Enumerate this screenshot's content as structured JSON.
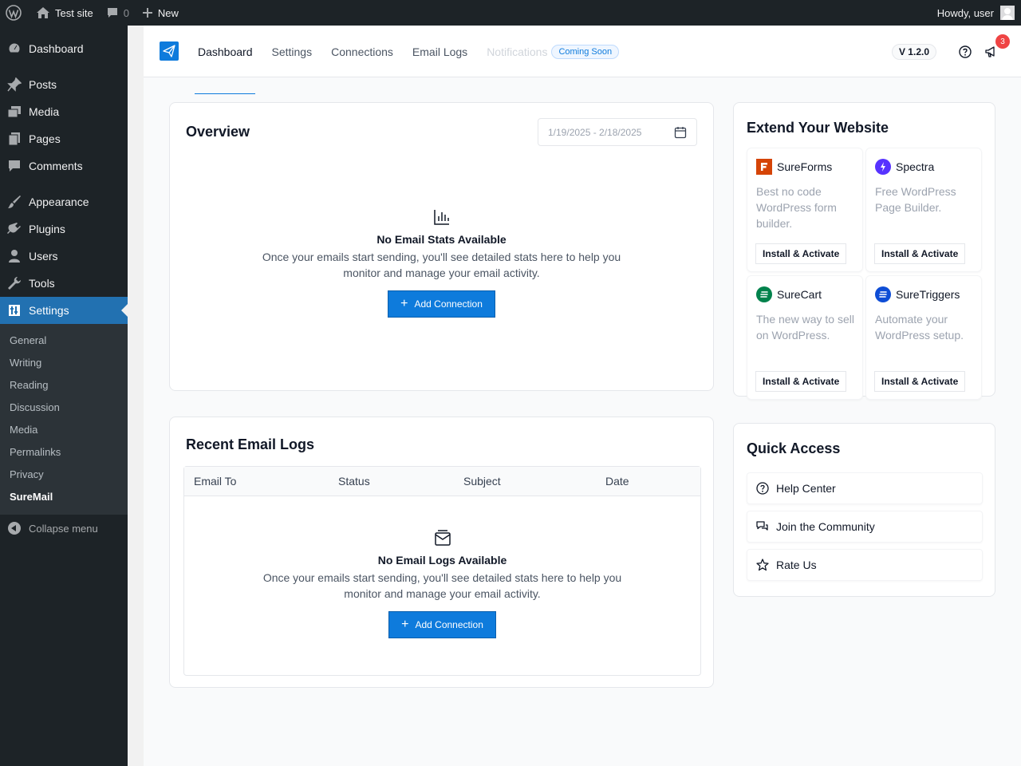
{
  "adminbar": {
    "site_name": "Test site",
    "comments_count": "0",
    "new_label": "New",
    "howdy": "Howdy, user"
  },
  "sidebar": {
    "items": [
      {
        "label": "Dashboard",
        "icon": "dashboard-icon"
      },
      {
        "label": "Posts",
        "icon": "pin-icon"
      },
      {
        "label": "Media",
        "icon": "media-icon"
      },
      {
        "label": "Pages",
        "icon": "pages-icon"
      },
      {
        "label": "Comments",
        "icon": "comments-icon"
      },
      {
        "label": "Appearance",
        "icon": "brush-icon"
      },
      {
        "label": "Plugins",
        "icon": "plug-icon"
      },
      {
        "label": "Users",
        "icon": "users-icon"
      },
      {
        "label": "Tools",
        "icon": "wrench-icon"
      },
      {
        "label": "Settings",
        "icon": "settings-icon"
      }
    ],
    "submenu": [
      "General",
      "Writing",
      "Reading",
      "Discussion",
      "Media",
      "Permalinks",
      "Privacy",
      "SureMail"
    ],
    "collapse": "Collapse menu"
  },
  "topnav": {
    "links": [
      "Dashboard",
      "Settings",
      "Connections",
      "Email Logs"
    ],
    "notifications": "Notifications",
    "coming_soon": "Coming Soon",
    "version": "V 1.2.0",
    "notif_count": "3"
  },
  "overview": {
    "title": "Overview",
    "date_range": "1/19/2025 - 2/18/2025",
    "empty_title": "No Email Stats Available",
    "empty_desc": "Once your emails start sending, you'll see detailed stats here to help you monitor and manage your email activity.",
    "button": "Add Connection"
  },
  "logs": {
    "title": "Recent Email Logs",
    "columns": [
      "Email To",
      "Status",
      "Subject",
      "Date"
    ],
    "empty_title": "No Email Logs Available",
    "empty_desc": "Once your emails start sending, you'll see detailed stats here to help you monitor and manage your email activity.",
    "button": "Add Connection"
  },
  "extend": {
    "title": "Extend Your Website",
    "plugins": [
      {
        "name": "SureForms",
        "desc": "Best no code WordPress form builder.",
        "button": "Install & Activate",
        "color": "#d54407"
      },
      {
        "name": "Spectra",
        "desc": "Free WordPress Page Builder.",
        "button": "Install & Activate",
        "color": "#5733ff"
      },
      {
        "name": "SureCart",
        "desc": "The new way to sell on WordPress.",
        "button": "Install & Activate",
        "color": "#01824c"
      },
      {
        "name": "SureTriggers",
        "desc": "Automate your WordPress setup.",
        "button": "Install & Activate",
        "color": "#0e4dd6"
      }
    ]
  },
  "quick": {
    "title": "Quick Access",
    "items": [
      "Help Center",
      "Join the Community",
      "Rate Us"
    ]
  },
  "colors": {
    "accent": "#0e7bdc",
    "wp_dark": "#1d2327",
    "wp_blue": "#2271b1"
  }
}
